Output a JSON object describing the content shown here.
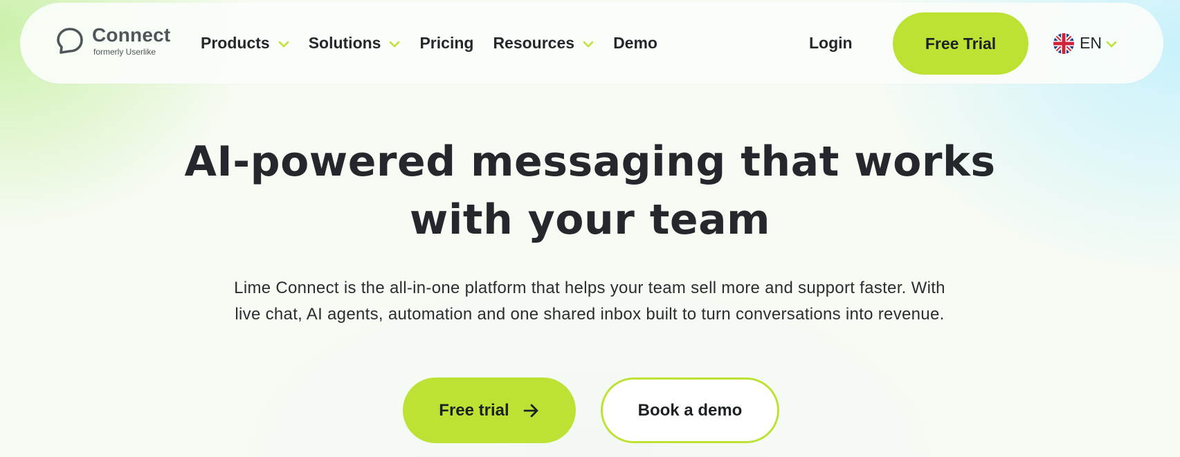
{
  "brand": {
    "name": "Connect",
    "subtitle": "formerly Userlike",
    "logo_icon": "chat-bubble-icon"
  },
  "nav": {
    "items": [
      {
        "label": "Products",
        "has_dropdown": true
      },
      {
        "label": "Solutions",
        "has_dropdown": true
      },
      {
        "label": "Pricing",
        "has_dropdown": false
      },
      {
        "label": "Resources",
        "has_dropdown": true
      },
      {
        "label": "Demo",
        "has_dropdown": false
      }
    ],
    "login_label": "Login",
    "trial_label": "Free Trial",
    "language": {
      "code": "EN",
      "flag_icon": "uk-flag-icon"
    }
  },
  "hero": {
    "title_line1": "AI-powered messaging that works",
    "title_line2": "with your team",
    "subtitle_line1": "Lime Connect is the all-in-one platform that helps your team sell more and support faster. With",
    "subtitle_line2": "live chat, AI agents, automation and one shared inbox built to turn conversations into revenue.",
    "primary_cta": "Free trial",
    "secondary_cta": "Book a demo"
  },
  "colors": {
    "accent": "#bde234",
    "text": "#24272b",
    "logo": "#4f5558"
  }
}
